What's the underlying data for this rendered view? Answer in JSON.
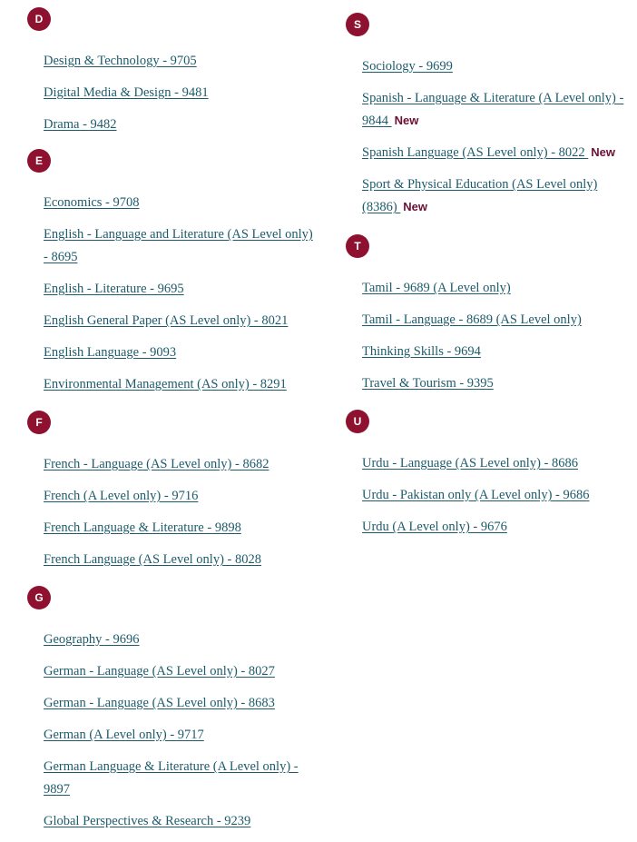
{
  "theme": {
    "badge_background": "#8e1230",
    "badge_text": "#ffffff",
    "link_color": "#1c5b6b",
    "new_flag_color": "#6b1033",
    "page_background": "#ffffff"
  },
  "columns": [
    {
      "side": "left",
      "groups": [
        {
          "letter": "D",
          "links": [
            {
              "label": "Design & Technology - 9705",
              "flag": ""
            },
            {
              "label": "Digital Media & Design - 9481",
              "flag": ""
            },
            {
              "label": "Drama - 9482",
              "flag": ""
            }
          ]
        },
        {
          "letter": "E",
          "links": [
            {
              "label": "Economics - 9708",
              "flag": ""
            },
            {
              "label": "English - Language and Literature (AS Level only) - 8695",
              "flag": ""
            },
            {
              "label": "English - Literature - 9695",
              "flag": ""
            },
            {
              "label": "English General Paper (AS Level only) - 8021",
              "flag": ""
            },
            {
              "label": "English Language - 9093",
              "flag": ""
            },
            {
              "label": "Environmental Management (AS only) - 8291",
              "flag": ""
            }
          ]
        },
        {
          "letter": "F",
          "links": [
            {
              "label": "French - Language (AS Level only) - 8682",
              "flag": ""
            },
            {
              "label": "French (A Level only) - 9716",
              "flag": ""
            },
            {
              "label": "French Language & Literature - 9898",
              "flag": ""
            },
            {
              "label": "French Language (AS Level only) - 8028",
              "flag": ""
            }
          ]
        },
        {
          "letter": "G",
          "links": [
            {
              "label": "Geography - 9696",
              "flag": ""
            },
            {
              "label": "German - Language (AS Level only) - 8027",
              "flag": ""
            },
            {
              "label": "German - Language (AS Level only) - 8683",
              "flag": ""
            },
            {
              "label": "German (A Level only) - 9717",
              "flag": ""
            },
            {
              "label": "German Language & Literature (A Level only) - 9897",
              "flag": ""
            },
            {
              "label": "Global Perspectives & Research - 9239",
              "flag": ""
            }
          ]
        }
      ]
    },
    {
      "side": "right",
      "groups": [
        {
          "letter": "S",
          "links": [
            {
              "label": "Sociology - 9699",
              "flag": ""
            },
            {
              "label": "Spanish - Language & Literature (A Level only) - 9844 ",
              "flag": "New"
            },
            {
              "label": "Spanish Language (AS Level only) - 8022 ",
              "flag": "New"
            },
            {
              "label": "Sport & Physical Education (AS Level only) (8386) ",
              "flag": "New"
            }
          ]
        },
        {
          "letter": "T",
          "links": [
            {
              "label": "Tamil - 9689 (A Level only)",
              "flag": ""
            },
            {
              "label": "Tamil - Language - 8689 (AS Level only)",
              "flag": ""
            },
            {
              "label": "Thinking Skills - 9694",
              "flag": ""
            },
            {
              "label": "Travel & Tourism - 9395",
              "flag": ""
            }
          ]
        },
        {
          "letter": "U",
          "links": [
            {
              "label": "Urdu - Language (AS Level only) - 8686",
              "flag": ""
            },
            {
              "label": "Urdu - Pakistan only (A Level only) - 9686",
              "flag": ""
            },
            {
              "label": "Urdu (A Level only) - 9676",
              "flag": ""
            }
          ]
        }
      ]
    }
  ]
}
